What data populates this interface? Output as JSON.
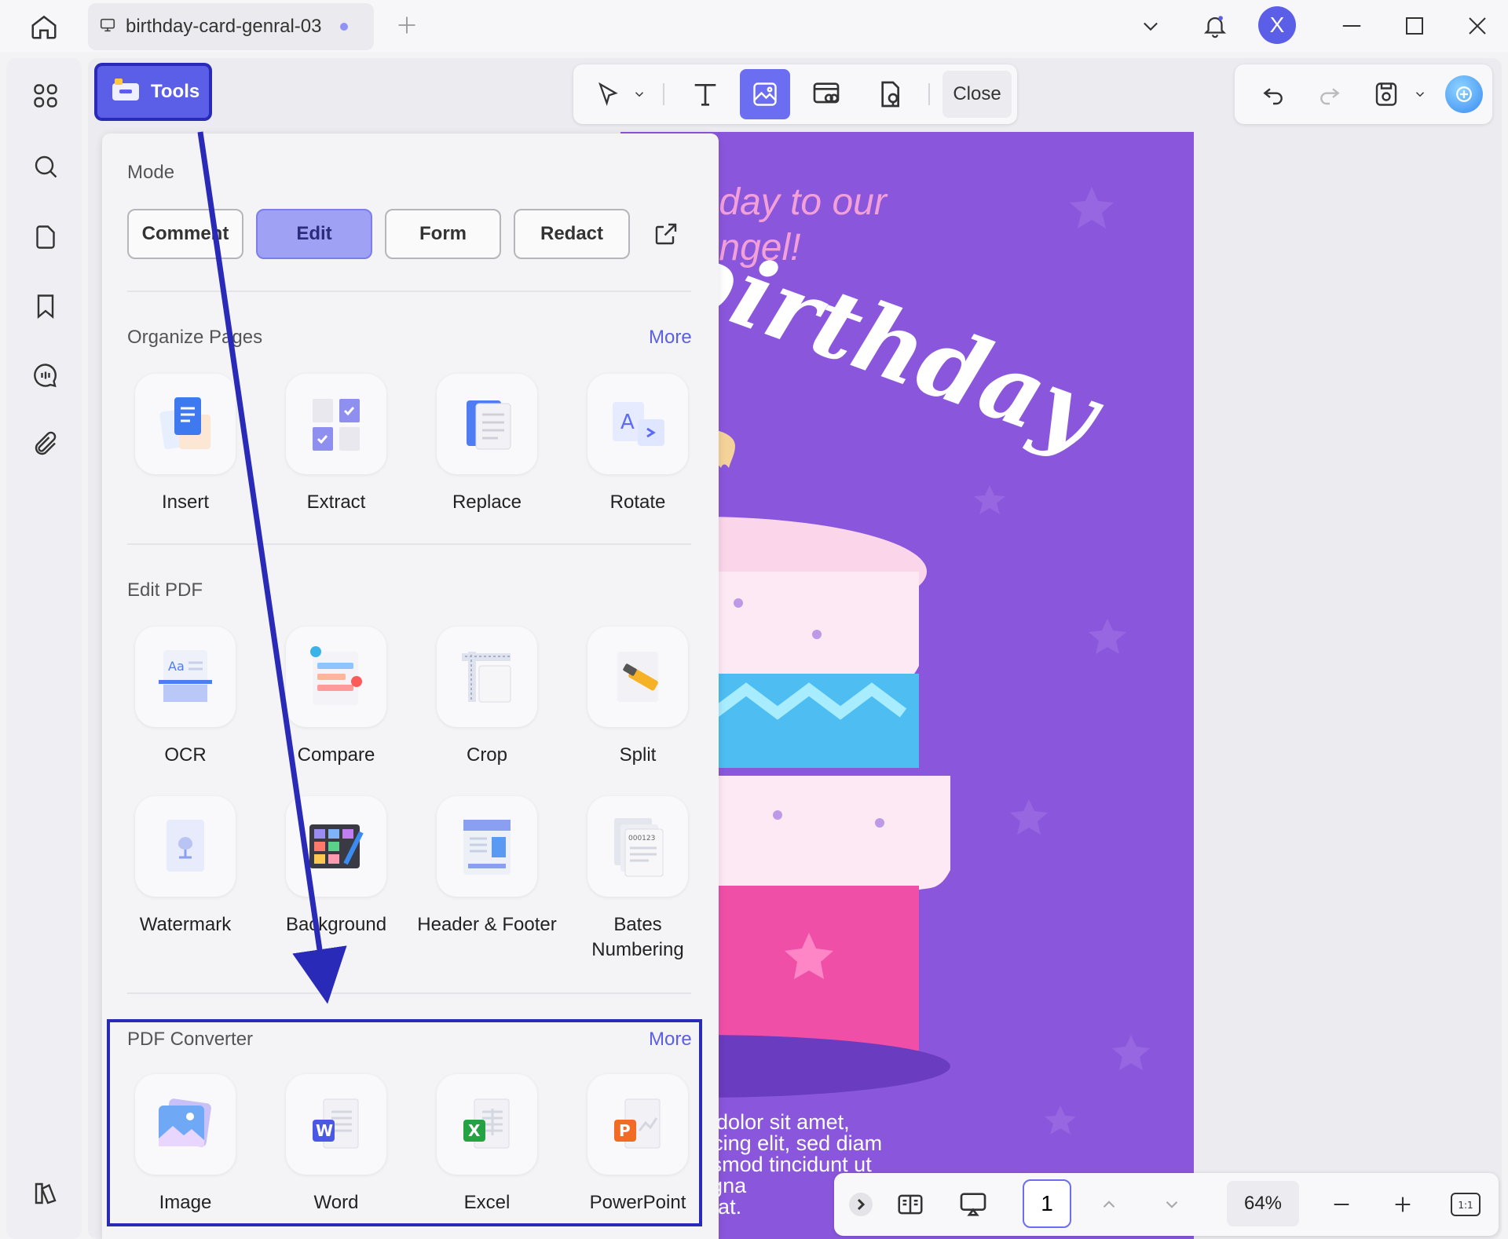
{
  "tab": {
    "title": "birthday-card-genral-03"
  },
  "user": {
    "initial": "X"
  },
  "tools_button": {
    "label": "Tools"
  },
  "toolbar": {
    "close_label": "Close"
  },
  "panel": {
    "mode": {
      "title": "Mode",
      "buttons": [
        "Comment",
        "Edit",
        "Form",
        "Redact"
      ],
      "active": "Edit"
    },
    "organize": {
      "title": "Organize Pages",
      "more": "More",
      "items": [
        "Insert",
        "Extract",
        "Replace",
        "Rotate"
      ]
    },
    "edit_pdf": {
      "title": "Edit PDF",
      "items": [
        "OCR",
        "Compare",
        "Crop",
        "Split",
        "Watermark",
        "Background",
        "Header & Footer",
        "Bates Numbering"
      ]
    },
    "converter": {
      "title": "PDF Converter",
      "more": "More",
      "items": [
        "Image",
        "Word",
        "Excel",
        "PowerPoint"
      ]
    }
  },
  "document": {
    "subtitle_line1": "t Birthday to our",
    "subtitle_line2": "little angel!",
    "headline": "birthday",
    "body_lines": [
      "n ipsum dolor sit amet,",
      "uer adipiscing elit, sed diam",
      "y nibh euismod tincidunt ut",
      "olore magna",
      "volutpat."
    ]
  },
  "status": {
    "page": "1",
    "zoom": "64%",
    "fit_label": "1:1"
  },
  "colors": {
    "accent": "#5b5fe8",
    "highlight_box": "#2a2ab8",
    "page_bg": "#8a57dc"
  }
}
